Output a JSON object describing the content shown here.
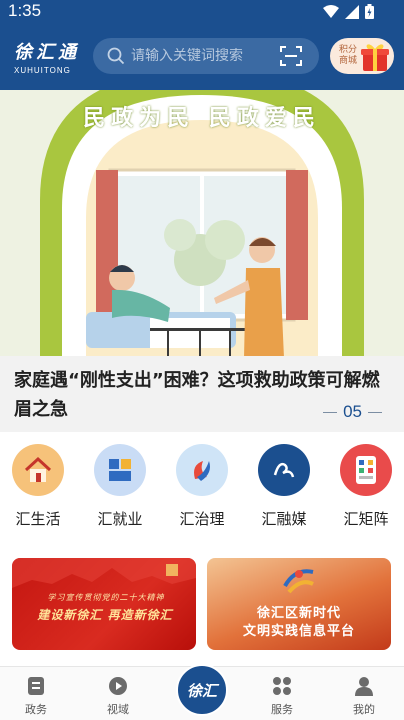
{
  "status_bar": {
    "time": "1:35"
  },
  "header": {
    "brand_name": "徐汇通",
    "brand_pinyin": "XUHUITONG",
    "search_placeholder": "请输入关键词搜索",
    "points_label": "积分商城"
  },
  "banner": {
    "arch_text": "民政为民 民政爱民",
    "title": "家庭遇“刚性支出”困难？这项救助政策可解燃眉之急",
    "page_indicator": "05"
  },
  "shortcuts": [
    {
      "label": "汇生活",
      "icon": "house-icon",
      "color": "#f6c27a"
    },
    {
      "label": "汇就业",
      "icon": "recruit-icon",
      "color": "#c9dcf5"
    },
    {
      "label": "汇治理",
      "icon": "governance-icon",
      "color": "#cfe4f7"
    },
    {
      "label": "汇融媒",
      "icon": "media-icon",
      "color": "#1b4f8f"
    },
    {
      "label": "汇矩阵",
      "icon": "apps-grid-icon",
      "color": "#e94b4b"
    }
  ],
  "promos": {
    "left_small": "学习宣传贯彻党的二十大精神",
    "left_big": "建设新徐汇  再造新徐汇",
    "right_line1": "徐汇区新时代",
    "right_line2": "文明实践信息平台"
  },
  "bottom_nav": {
    "items": [
      {
        "label": "政务",
        "icon": "document-icon"
      },
      {
        "label": "视域",
        "icon": "play-icon"
      },
      {
        "label": "服务",
        "icon": "grid-icon"
      },
      {
        "label": "我的",
        "icon": "person-icon"
      }
    ],
    "center_logo": "徐汇"
  }
}
